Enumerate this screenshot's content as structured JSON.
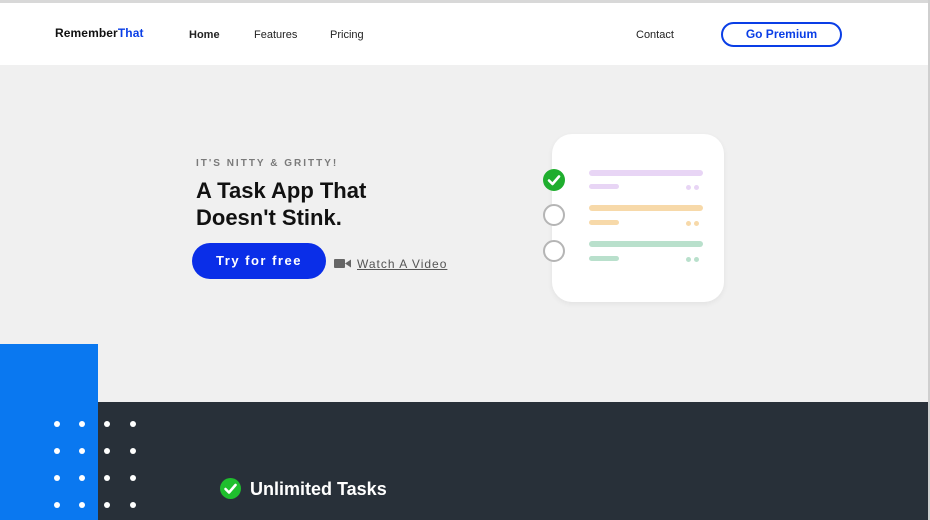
{
  "nav": {
    "logo_main": "Remember",
    "logo_accent": "That",
    "links": [
      {
        "label": "Home",
        "active": true
      },
      {
        "label": "Features",
        "active": false
      },
      {
        "label": "Pricing",
        "active": false
      }
    ],
    "contact": "Contact",
    "premium": "Go Premium"
  },
  "hero": {
    "eyebrow": "IT'S NITTY & GRITTY!",
    "headline": "A Task App That Doesn't Stink.",
    "try_button": "Try for free",
    "watch_link": "Watch A Video",
    "video_icon": "video-camera-icon"
  },
  "card": {
    "tasks": [
      {
        "status": "done",
        "bar_color": "#e8d5f5",
        "sub_color": "#e8d5f5",
        "dot_color": "#e8d5f5"
      },
      {
        "status": "open",
        "bar_color": "#f7d9a9",
        "sub_color": "#f7d9a9",
        "dot_color": "#f7d9a9"
      },
      {
        "status": "open",
        "bar_color": "#b9e0cc",
        "sub_color": "#b9e0cc",
        "dot_color": "#b9e0cc"
      }
    ]
  },
  "features": {
    "first": "Unlimited Tasks"
  },
  "colors": {
    "accent_blue": "#0a3ee6",
    "button_blue": "#0a2ee8",
    "block_blue": "#0a78f0",
    "dark_band": "#283039",
    "check_green": "#1fae2e"
  }
}
